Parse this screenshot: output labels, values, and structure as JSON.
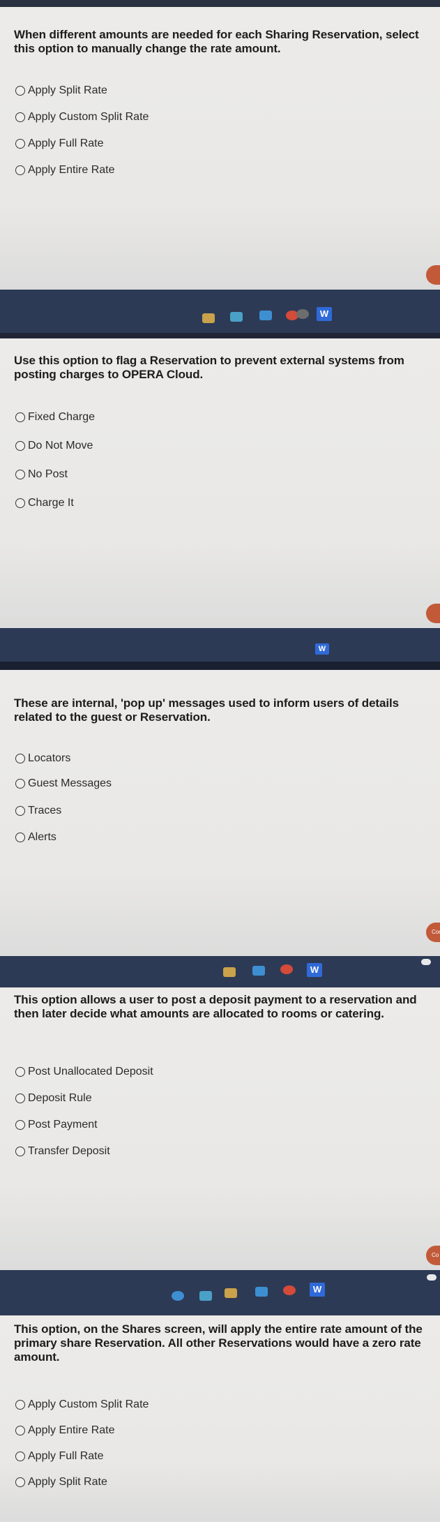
{
  "screens": [
    {
      "question": "When different amounts are needed for each Sharing Reservation, select this option to manually change the rate amount.",
      "options": [
        "Apply Split Rate",
        "Apply Custom Split Rate",
        "Apply Full Rate",
        "Apply Entire Rate"
      ]
    },
    {
      "question": "Use this option to flag a Reservation to prevent external systems from posting charges to OPERA Cloud.",
      "options": [
        "Fixed Charge",
        "Do Not Move",
        "No Post",
        "Charge It"
      ]
    },
    {
      "question": "These are internal, 'pop up' messages used to inform users of details related to the guest or Reservation.",
      "options": [
        "Locators",
        "Guest Messages",
        "Traces",
        "Alerts"
      ],
      "button_label": "Conf"
    },
    {
      "question": "This option allows a user to post a deposit payment to a reservation and then later decide what amounts are allocated to rooms or catering.",
      "options": [
        "Post Unallocated Deposit",
        "Deposit Rule",
        "Post Payment",
        "Transfer Deposit"
      ],
      "button_label": "Co"
    },
    {
      "question": "This option, on the Shares screen, will apply the entire rate amount of the primary share Reservation. All other Reservations would have a zero rate amount.",
      "options": [
        "Apply Custom Split Rate",
        "Apply Entire Rate",
        "Apply Full Rate",
        "Apply Split Rate"
      ]
    }
  ],
  "taskbar": {
    "word_icon": "W",
    "colors": {
      "word": "#2f6ad8",
      "taskbar": "#2d3a55",
      "orange_button": "#c25a3a"
    }
  }
}
